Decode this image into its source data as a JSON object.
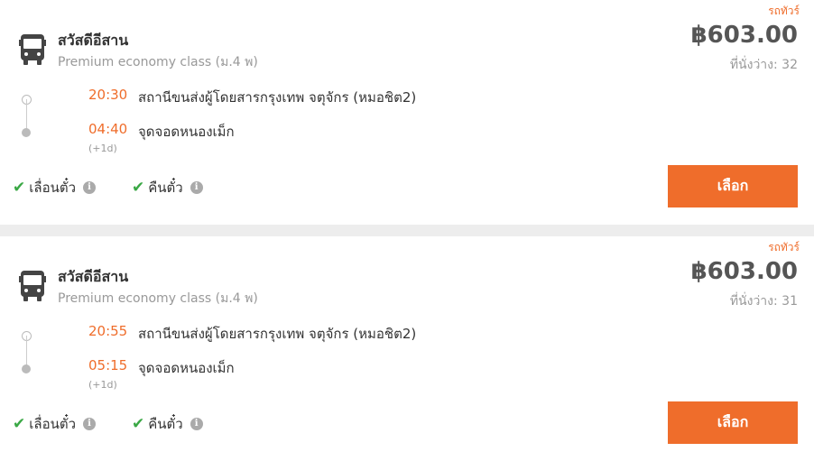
{
  "trips": [
    {
      "tag": "รถทัวร์",
      "operator": "สวัสดีอีสาน",
      "class": "Premium economy class (ม.4 พ)",
      "price": "฿603.00",
      "seats": "ที่นั่งว่าง: 32",
      "depart_time": "20:30",
      "depart_place": "สถานีขนส่งผู้โดยสารกรุงเทพ จตุจักร (หมอชิต2)",
      "arrive_time": "04:40",
      "arrive_place": "จุดจอดหนองเม็ก",
      "next_day": "(+1d)",
      "policy_reschedule": "เลื่อนตั๋ว",
      "policy_refund": "คืนตั๋ว",
      "select_label": "เลือก"
    },
    {
      "tag": "รถทัวร์",
      "operator": "สวัสดีอีสาน",
      "class": "Premium economy class (ม.4 พ)",
      "price": "฿603.00",
      "seats": "ที่นั่งว่าง: 31",
      "depart_time": "20:55",
      "depart_place": "สถานีขนส่งผู้โดยสารกรุงเทพ จตุจักร (หมอชิต2)",
      "arrive_time": "05:15",
      "arrive_place": "จุดจอดหนองเม็ก",
      "next_day": "(+1d)",
      "policy_reschedule": "เลื่อนตั๋ว",
      "policy_refund": "คืนตั๋ว",
      "select_label": "เลือก"
    }
  ],
  "icons": {
    "bus": "bus-icon",
    "check": "check-icon",
    "info": "info-icon"
  },
  "colors": {
    "accent": "#ef6d2b",
    "check": "#3aa845",
    "muted": "#999999"
  }
}
